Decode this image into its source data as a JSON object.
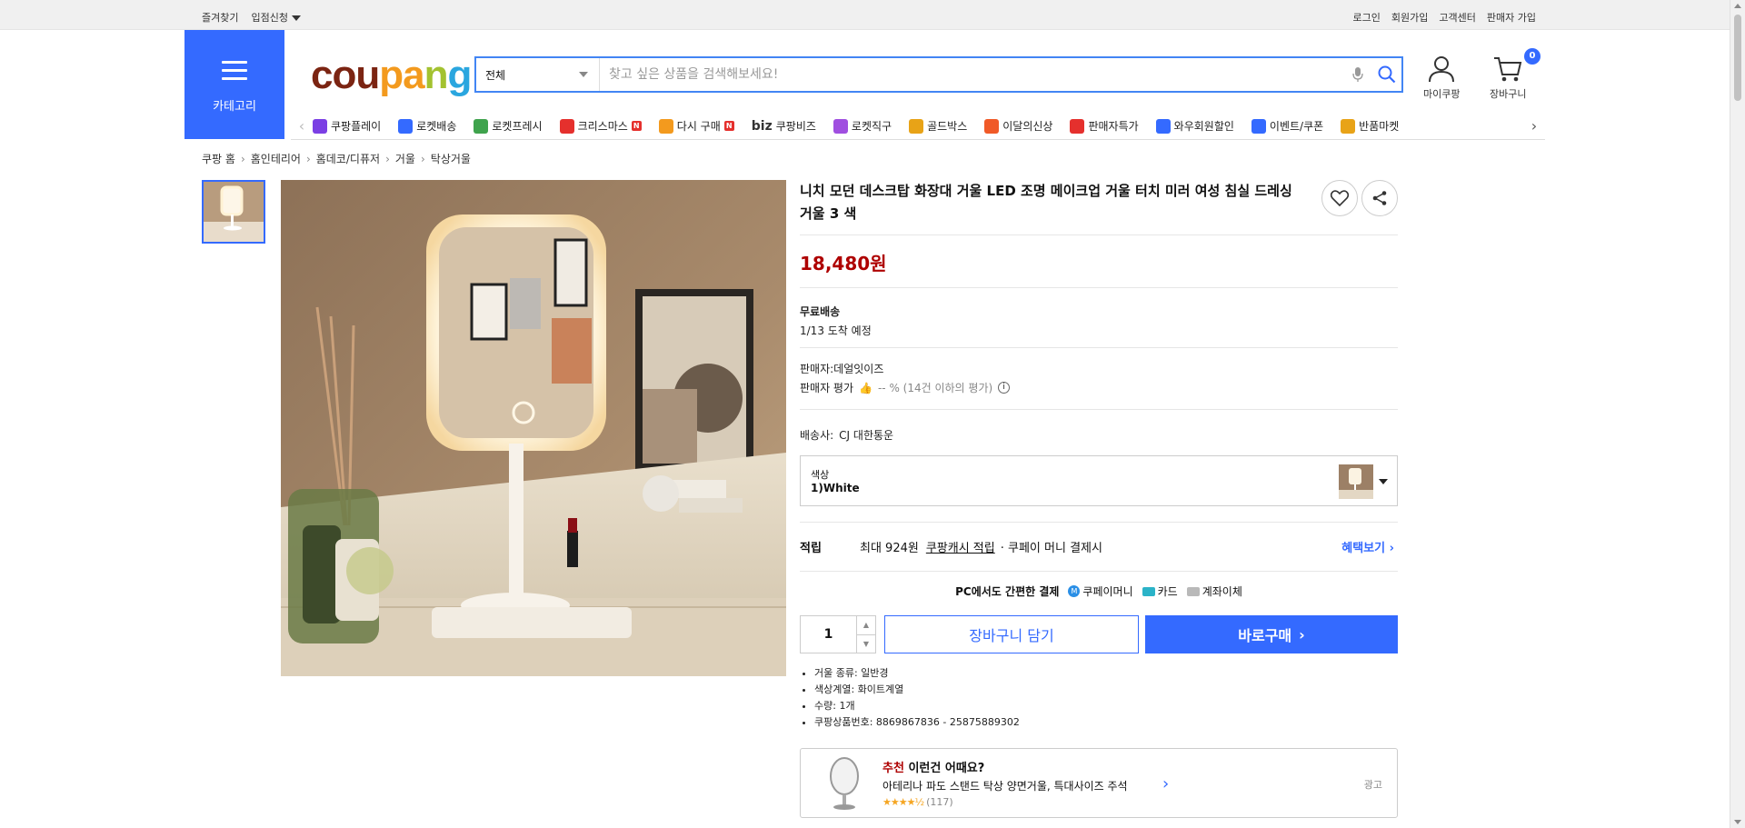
{
  "topbar": {
    "bookmark": "즐겨찾기",
    "store_apply": "입점신청",
    "login": "로그인",
    "signup": "회원가입",
    "support": "고객센터",
    "seller_signup": "판매자 가입"
  },
  "header": {
    "category_label": "카테고리",
    "logo": {
      "c1": "cou",
      "c2": "pa",
      "c3": "n",
      "c4": "g"
    },
    "search_category": "전체",
    "search_placeholder": "찾고 싶은 상품을 검색해보세요!",
    "my_coupang": "마이쿠팡",
    "cart": "장바구니",
    "cart_count": "0"
  },
  "subnav": [
    {
      "label": "쿠팡플레이",
      "icon": "play-icon",
      "color": "#7b3fe4"
    },
    {
      "label": "로켓배송",
      "icon": "rocket-icon",
      "color": "#346aff"
    },
    {
      "label": "로켓프레시",
      "icon": "rocket-fresh-icon",
      "color": "#3fa34d"
    },
    {
      "label": "크리스마스",
      "icon": "santa-icon",
      "color": "#e5302d",
      "badge": "N"
    },
    {
      "label": "다시 구매",
      "icon": "home-icon",
      "color": "#f39a1e",
      "badge": "N"
    },
    {
      "label": "쿠팡비즈",
      "icon": "biz-icon",
      "color": "#333333",
      "prefix": "biz"
    },
    {
      "label": "로켓직구",
      "icon": "globe-icon",
      "color": "#a04fe0"
    },
    {
      "label": "골드박스",
      "icon": "goldbox-icon",
      "color": "#e8a317"
    },
    {
      "label": "이달의신상",
      "icon": "new-icon",
      "color": "#f05a28"
    },
    {
      "label": "판매자특가",
      "icon": "percent-icon",
      "color": "#e5302d"
    },
    {
      "label": "와우회원할인",
      "icon": "wow-icon",
      "color": "#346aff"
    },
    {
      "label": "이벤트/쿠폰",
      "icon": "coupon-icon",
      "color": "#346aff"
    },
    {
      "label": "반품마켓",
      "icon": "return-icon",
      "color": "#e8a317"
    }
  ],
  "breadcrumb": [
    "쿠팡 홈",
    "홈인테리어",
    "홈데코/디퓨저",
    "거울",
    "탁상거울"
  ],
  "product": {
    "title": "니치 모던 데스크탑 화장대 거울 LED 조명 메이크업 거울 터치 미러 여성 침실 드레싱 거울 3 색",
    "price": "18,480원",
    "shipping_free": "무료배송",
    "arrival": "1/13 도착 예정",
    "seller": "판매자:데얼잇이즈",
    "seller_rating_label": "판매자 평가",
    "seller_rating_value": "-- % (14건 이하의 평가)",
    "carrier_label": "배송사:",
    "carrier": "CJ 대한통운",
    "option_label": "색상",
    "option_value": "1)White",
    "reward_label": "적립",
    "reward_text": "최대 924원",
    "reward_link": "쿠팡캐시 적립",
    "reward_suffix": "· 쿠페이 머니 결제시",
    "benefit_link": "혜택보기",
    "pay_title": "PC에서도 간편한 결제",
    "pay_methods": [
      "쿠페이머니",
      "카드",
      "계좌이체"
    ],
    "quantity": "1",
    "add_to_cart": "장바구니 담기",
    "buy_now": "바로구매",
    "specs": [
      "거울 종류: 일반경",
      "색상계열: 화이트계열",
      "수량: 1개",
      "쿠팡상품번호: 8869867836 - 25875889302"
    ]
  },
  "recommend": {
    "highlight": "추천",
    "title_rest": " 이런건 어때요?",
    "item": "아테리나 파도 스탠드 탁상 양면거울, 특대사이즈 주석",
    "rating": 4.5,
    "reviews": "(117)",
    "ad_label": "광고"
  }
}
